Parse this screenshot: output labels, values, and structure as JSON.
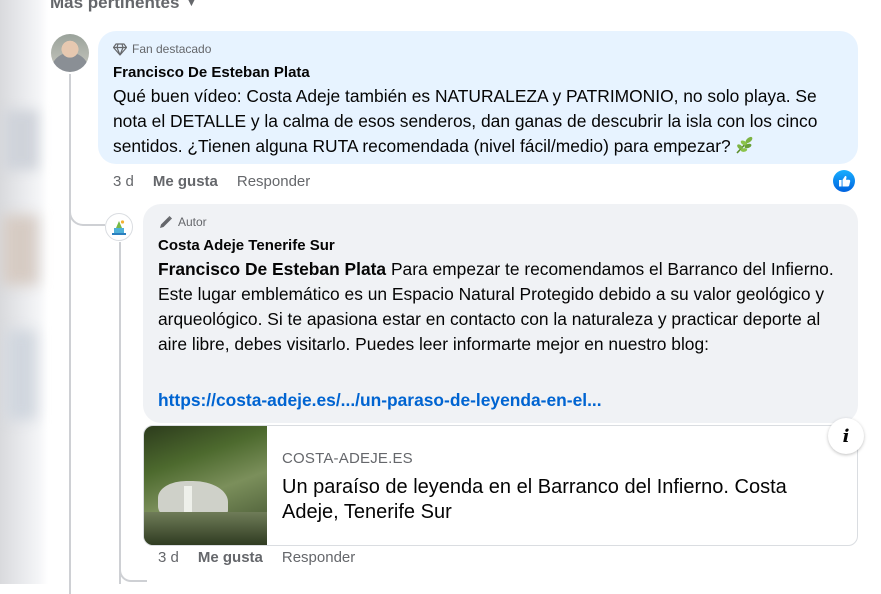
{
  "sort": {
    "label": "Más pertinentes",
    "icon": "caret-down-icon"
  },
  "comments": [
    {
      "badge_icon": "diamond-icon",
      "badge": "Fan destacado",
      "author": "Francisco De Esteban Plata",
      "text": "Qué buen vídeo: Costa Adeje también es NATURALEZA y PATRIMONIO, no solo playa. Se nota el DETALLE y la calma de esos senderos, dan ganas de descubrir la isla con los cinco sentidos. ¿Tienen alguna RUTA recomendada (nivel fácil/medio) para empezar?",
      "emoji": "herb-icon",
      "time": "3 d",
      "like": "Me gusta",
      "reply": "Responder",
      "reaction": "like-icon"
    },
    {
      "badge_icon": "pencil-icon",
      "badge": "Autor",
      "author": "Costa Adeje Tenerife Sur",
      "mention": "Francisco De Esteban Plata",
      "text": " Para empezar te recomendamos el Barranco del Infierno. Este lugar emblemático es un Espacio Natural Protegido debido a su valor geológico y arqueológico. Si te apasiona estar en contacto con la naturaleza y practicar deporte al aire libre, debes visitarlo. Puedes leer informarte mejor en nuestro blog:",
      "link": "https://costa-adeje.es/.../un-paraso-de-leyenda-en-el...",
      "preview": {
        "domain": "COSTA-ADEJE.ES",
        "title": "Un paraíso de leyenda en el Barranco del Infierno. Costa Adeje, Tenerife Sur",
        "info_icon": "info-icon"
      },
      "time": "3 d",
      "like": "Me gusta",
      "reply": "Responder"
    }
  ],
  "colors": {
    "bubble_reply": "#f0f2f5",
    "bubble_fan": "#e7f3ff",
    "link": "#0064d1",
    "meta": "#65676b"
  }
}
